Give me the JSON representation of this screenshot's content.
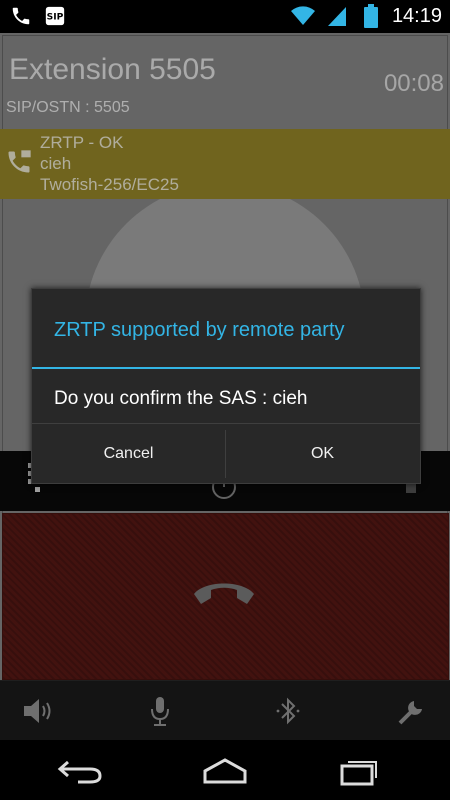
{
  "status_bar": {
    "time": "14:19",
    "icons": [
      "phone-icon",
      "voicemail-app-icon",
      "wifi-icon",
      "signal-icon",
      "battery-icon"
    ]
  },
  "call": {
    "caller_name": "Extension 5505",
    "timer": "00:08",
    "number_line": "SIP/OSTN : 5505"
  },
  "zrtp_banner": {
    "status": "ZRTP - OK",
    "sas": "cieh",
    "cipher": "Twofish-256/EC25",
    "accent": "#9b8b2a"
  },
  "dialog": {
    "title": "ZRTP supported by remote party",
    "message": "Do you confirm the SAS : cieh",
    "cancel_label": "Cancel",
    "ok_label": "OK",
    "accent": "#33b5e5"
  },
  "toolbar": {
    "items": [
      "speaker-icon",
      "microphone-icon",
      "bluetooth-icon",
      "settings-wrench-icon"
    ]
  },
  "navbar": {
    "items": [
      "back-icon",
      "home-icon",
      "recent-apps-icon"
    ]
  },
  "colors": {
    "hangup_background": "#5c1a16",
    "call_background": "#8c8c8c"
  }
}
